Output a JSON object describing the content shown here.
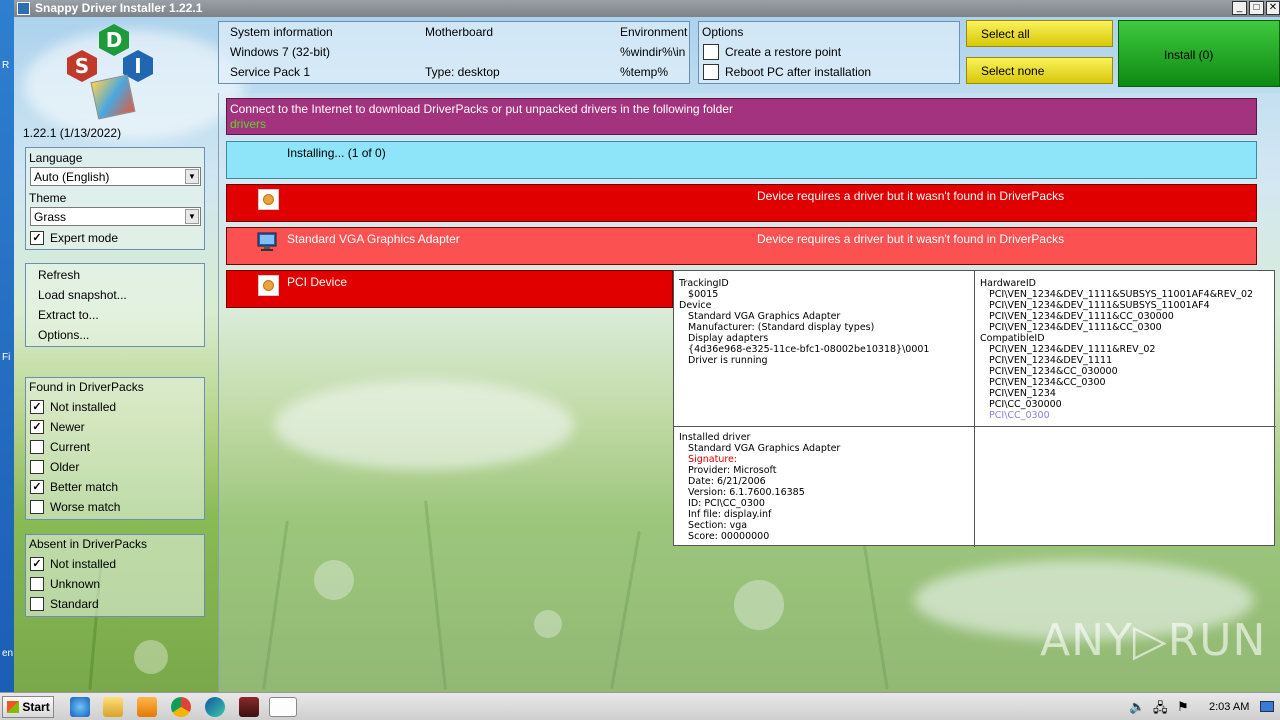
{
  "window": {
    "title": "Snappy Driver Installer 1.22.1",
    "minimize": "_",
    "maximize": "□",
    "close": "✕"
  },
  "desktop": {
    "left_texts": [
      "R",
      "Fi",
      "en"
    ]
  },
  "logo": {
    "letters": [
      "D",
      "S",
      "I"
    ],
    "version": "1.22.1 (1/13/2022)"
  },
  "settings": {
    "language_label": "Language",
    "language_value": "Auto (English)",
    "theme_label": "Theme",
    "theme_value": "Grass",
    "expert_mode": {
      "label": "Expert mode",
      "checked": true
    }
  },
  "menu": [
    "Refresh",
    "Load snapshot...",
    "Extract to...",
    "Options..."
  ],
  "found": {
    "title": "Found in DriverPacks",
    "items": [
      {
        "label": "Not installed",
        "checked": true
      },
      {
        "label": "Newer",
        "checked": true
      },
      {
        "label": "Current",
        "checked": false
      },
      {
        "label": "Older",
        "checked": false
      },
      {
        "label": "Better match",
        "checked": true
      },
      {
        "label": "Worse match",
        "checked": false
      }
    ]
  },
  "absent": {
    "title": "Absent in DriverPacks",
    "items": [
      {
        "label": "Not installed",
        "checked": true
      },
      {
        "label": "Unknown",
        "checked": false
      },
      {
        "label": "Standard",
        "checked": false
      }
    ]
  },
  "sysinfo": {
    "col1": [
      "System information",
      "Windows 7 (32-bit)",
      "Service Pack 1"
    ],
    "col2": [
      "Motherboard",
      "",
      "Type: desktop"
    ],
    "col3": [
      "Environment",
      "%windir%\\in",
      "%temp%"
    ]
  },
  "options": {
    "title": "Options",
    "restore_point": "Create a restore point",
    "reboot": "Reboot PC after installation"
  },
  "buttons": {
    "select_all": "Select all",
    "select_none": "Select none",
    "install": "Install (0)"
  },
  "messages": {
    "connect": "Connect to the Internet to download DriverPacks or put unpacked drivers in the following folder",
    "folder": "drivers",
    "installing": "Installing...  (1 of 0)"
  },
  "devices": [
    {
      "name": "",
      "status": "Device requires a driver but it wasn't found in DriverPacks",
      "color": "#e00000"
    },
    {
      "name": "Standard VGA Graphics Adapter",
      "status": "Device requires a driver but it wasn't found in DriverPacks",
      "color": "#fb5151"
    },
    {
      "name": "PCI Device",
      "status": "",
      "color": "#e00000"
    }
  ],
  "tooltip": {
    "device_info": "TrackingID\n   $0015\nDevice\n   Standard VGA Graphics Adapter\n   Manufacturer: (Standard display types)\n   Display adapters\n   {4d36e968-e325-11ce-bfc1-08002be10318}\\0001\n   Driver is running",
    "hardware_ids": "HardwareID\n   PCI\\VEN_1234&DEV_1111&SUBSYS_11001AF4&REV_02\n   PCI\\VEN_1234&DEV_1111&SUBSYS_11001AF4\n   PCI\\VEN_1234&DEV_1111&CC_030000\n   PCI\\VEN_1234&DEV_1111&CC_0300\nCompatibleID\n   PCI\\VEN_1234&DEV_1111&REV_02\n   PCI\\VEN_1234&DEV_1111\n   PCI\\VEN_1234&CC_030000\n   PCI\\VEN_1234&CC_0300\n   PCI\\VEN_1234\n   PCI\\CC_030000",
    "hardware_last": "   PCI\\CC_0300",
    "installed_head": "Installed driver\n   Standard VGA Graphics Adapter",
    "signature": "   Signature:",
    "installed_rest": "   Provider: Microsoft\n   Date: 6/21/2006\n   Version: 6.1.7600.16385\n   ID: PCI\\CC_0300\n   Inf file: display.inf\n   Section: vga\n   Score: 00000000"
  },
  "watermark": "ANY▷RUN",
  "taskbar": {
    "start": "Start",
    "clock": "2:03 AM"
  },
  "colors": {
    "purple": "#a3337e",
    "cyan": "#8ee5fa",
    "red": "#e00000",
    "light_red": "#fb5151",
    "green_text": "#5fd32a"
  }
}
